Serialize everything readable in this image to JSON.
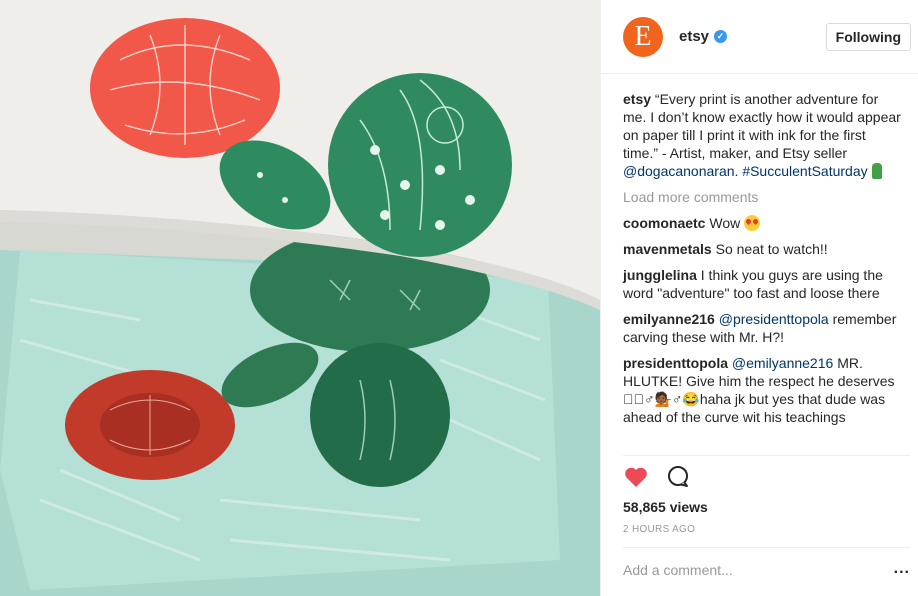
{
  "post": {
    "media_alt": "Linocut print of cactus with red flowers being pulled from inked block",
    "header": {
      "avatar_letter": "E",
      "avatar_color": "#f1641e",
      "username": "etsy",
      "verified_icon": "verified-badge-icon",
      "follow_label": "Following"
    },
    "caption": {
      "user": "etsy",
      "text_1": "“Every print is another adventure for me. I don’t know exactly how it would appear on paper till I print it with ink for the first time.” - Artist, maker, and Etsy seller ",
      "mention": "@dogacanonaran",
      "text_2": ". ",
      "hashtag": "#SucculentSaturday",
      "emoji": "cactus-emoji"
    },
    "load_more": "Load more comments",
    "comments": [
      {
        "user": "coomonaetc",
        "text": "Wow",
        "emoji": "heart-eyes-emoji"
      },
      {
        "user": "mavenmetals",
        "text": "So neat to watch!!"
      },
      {
        "user": "jungglelina",
        "text": "I think you guys are using the word \"adventure\" too fast and loose there"
      },
      {
        "user": "emilyanne216",
        "mention": "@presidenttopola",
        "text": "remember carving these with Mr. H?!"
      },
      {
        "user": "presidenttopola",
        "mention": "@emilyanne216",
        "text": "MR. HLUTKE! Give him the respect he deserves ☐🏽♂💁🏾♂😂haha jk but yes that dude was ahead of the curve wit his teachings"
      }
    ],
    "actions": {
      "like_icon": "heart-icon",
      "comment_icon": "comment-icon",
      "like_color": "#ed4956"
    },
    "views": "58,865 views",
    "time": "2 HOURS AGO",
    "add_comment_placeholder": "Add a comment...",
    "more_label": "..."
  }
}
